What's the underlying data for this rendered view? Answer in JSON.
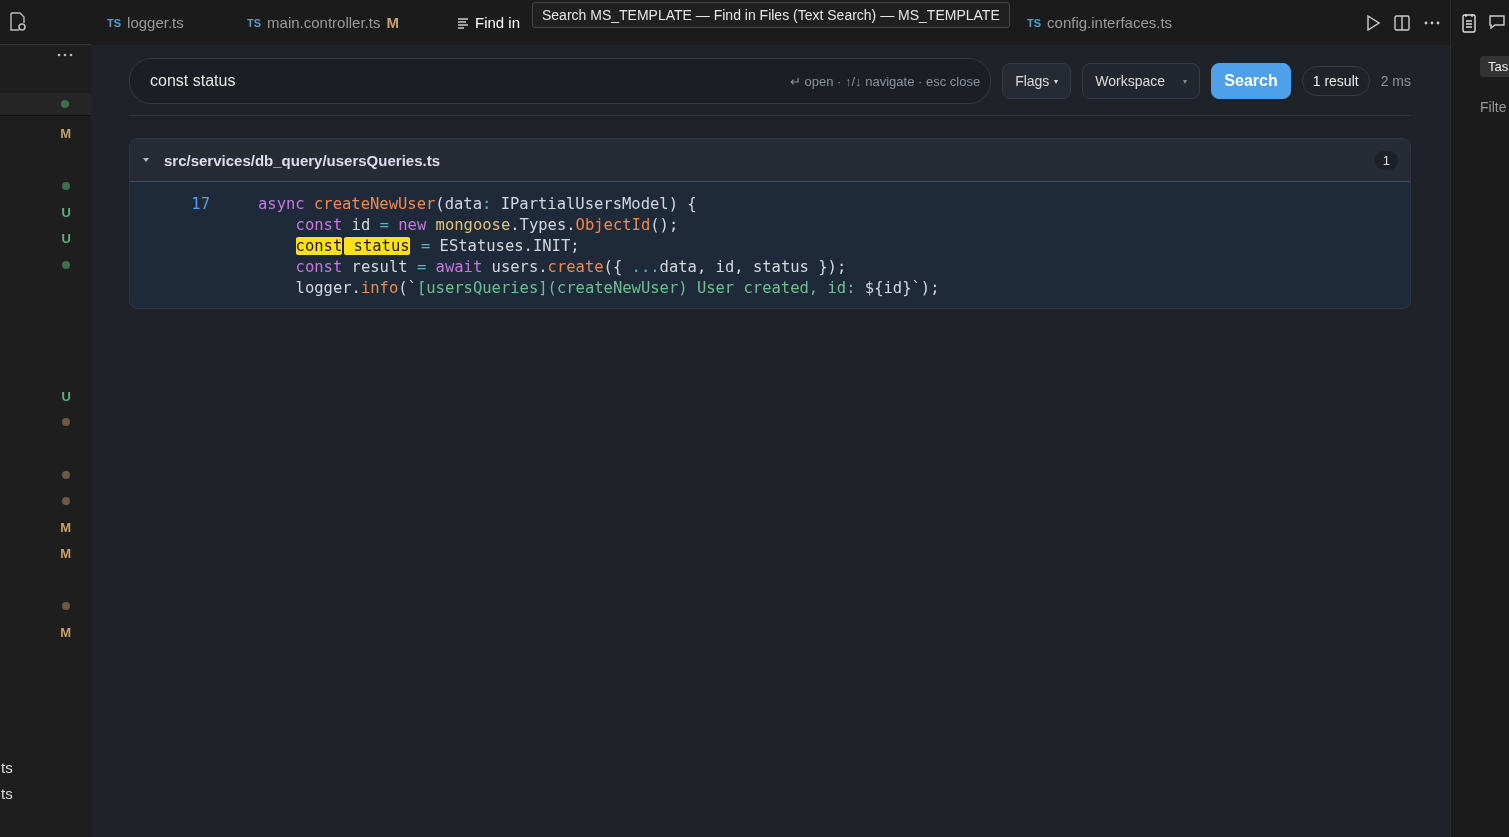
{
  "sidebar": {
    "selected_row": {
      "decoration": {
        "kind": "dot",
        "color": "#3f6f4f"
      }
    },
    "rows": [
      {
        "kind": "letter",
        "text": "M",
        "color": "#c7a06a"
      },
      {
        "kind": "empty"
      },
      {
        "kind": "dot",
        "color": "#3f6f4f"
      },
      {
        "kind": "letter",
        "text": "U",
        "color": "#5fb07a"
      },
      {
        "kind": "letter",
        "text": "U",
        "color": "#5fb07a"
      },
      {
        "kind": "dot",
        "color": "#3f6f4f"
      },
      {
        "kind": "empty"
      },
      {
        "kind": "empty"
      },
      {
        "kind": "empty"
      },
      {
        "kind": "empty"
      },
      {
        "kind": "letter",
        "text": "U",
        "color": "#5fb07a"
      },
      {
        "kind": "dot",
        "color": "#6b5a44"
      },
      {
        "kind": "empty"
      },
      {
        "kind": "dot",
        "color": "#6b5a44"
      },
      {
        "kind": "dot",
        "color": "#6b5a44"
      },
      {
        "kind": "letter",
        "text": "M",
        "color": "#c7a06a"
      },
      {
        "kind": "letter",
        "text": "M",
        "color": "#c7a06a"
      },
      {
        "kind": "empty"
      },
      {
        "kind": "dot",
        "color": "#6b5a44"
      },
      {
        "kind": "letter",
        "text": "M",
        "color": "#c7a06a"
      }
    ],
    "bottom_items": [
      "ts",
      "ts"
    ]
  },
  "tabs": [
    {
      "label": "logger.ts",
      "kind": "ts",
      "icon_text": "TS",
      "selected": false
    },
    {
      "label": "main.controller.ts",
      "kind": "ts",
      "icon_text": "TS",
      "badge": "M",
      "selected": false
    },
    {
      "label": "Find in",
      "kind": "search",
      "selected": true
    },
    {
      "label": "config.interfaces.ts",
      "kind": "ts",
      "icon_text": "TS",
      "selected": false
    }
  ],
  "tooltip": "Search MS_TEMPLATE — Find in Files (Text Search) — MS_TEMPLATE",
  "search": {
    "value": "const status",
    "hint": "↵ open · ↑/↓ navigate · esc close",
    "flags": "Flags",
    "flags_caret": "▾",
    "scope": "Workspace",
    "scope_caret": "▾",
    "button": "Search",
    "result_count": "1 result",
    "time": "2 ms"
  },
  "results": [
    {
      "path": "src/services/db_query/usersQueries.ts",
      "count": "1",
      "expanded": true,
      "lines": [
        {
          "number": "17",
          "indented": false,
          "tokens": [
            {
              "text": "async ",
              "kind": "keyword"
            },
            {
              "text": "createNewUser",
              "kind": "function"
            },
            {
              "text": "(data",
              "kind": "plain"
            },
            {
              "text": ":",
              "kind": "operator"
            },
            {
              "text": " IPartialUsersModel) {",
              "kind": "plain"
            }
          ]
        },
        {
          "indented": true,
          "tokens": [
            {
              "text": "const",
              "kind": "keyword"
            },
            {
              "text": " id ",
              "kind": "plain"
            },
            {
              "text": "=",
              "kind": "operator"
            },
            {
              "text": " new ",
              "kind": "keyword"
            },
            {
              "text": "mongoose",
              "kind": "type"
            },
            {
              "text": ".Types.",
              "kind": "plain"
            },
            {
              "text": "ObjectId",
              "kind": "function"
            },
            {
              "text": "();",
              "kind": "plain"
            }
          ]
        },
        {
          "indented": true,
          "tokens": [
            {
              "text": "const",
              "kind": "match"
            },
            {
              "text": " status",
              "kind": "match"
            },
            {
              "text": " =",
              "kind": "operator"
            },
            {
              "text": " EStatuses.INIT;",
              "kind": "plain"
            }
          ]
        },
        {
          "indented": true,
          "tokens": [
            {
              "text": "const",
              "kind": "keyword"
            },
            {
              "text": " result ",
              "kind": "plain"
            },
            {
              "text": "=",
              "kind": "operator"
            },
            {
              "text": " await",
              "kind": "keyword"
            },
            {
              "text": " users.",
              "kind": "plain"
            },
            {
              "text": "create",
              "kind": "function"
            },
            {
              "text": "({ ",
              "kind": "plain"
            },
            {
              "text": "...",
              "kind": "operator"
            },
            {
              "text": "data, id, status });",
              "kind": "plain"
            }
          ]
        },
        {
          "indented": true,
          "tokens": [
            {
              "text": "logger.",
              "kind": "plain"
            },
            {
              "text": "info",
              "kind": "function"
            },
            {
              "text": "(`",
              "kind": "plain"
            },
            {
              "text": "[usersQueries](createNewUser) User created, id: ",
              "kind": "string"
            },
            {
              "text": "${id}",
              "kind": "plain"
            },
            {
              "text": "`);",
              "kind": "plain"
            }
          ]
        }
      ]
    }
  ],
  "right_panel": {
    "button": "Tas",
    "label": "Filte"
  }
}
